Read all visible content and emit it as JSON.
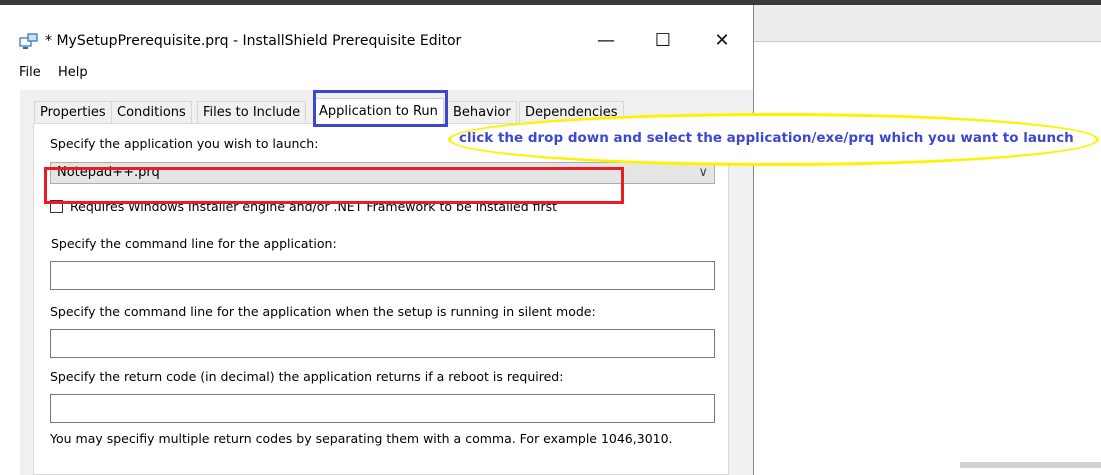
{
  "window": {
    "title": "* MySetupPrerequisite.prq - InstallShield Prerequisite Editor",
    "minimize_glyph": "—",
    "maximize_glyph": "☐",
    "close_glyph": "✕"
  },
  "menu": {
    "file": "File",
    "help": "Help"
  },
  "tabs": [
    {
      "label": "Properties"
    },
    {
      "label": "Conditions"
    },
    {
      "label": "Files to Include"
    },
    {
      "label": "Application to Run",
      "active": true
    },
    {
      "label": "Behavior"
    },
    {
      "label": "Dependencies"
    }
  ],
  "panel": {
    "launch_label": "Specify the application you wish to launch:",
    "application_value": "Notepad++.prq",
    "requires_label": "Requires Windows Installer engine and/or .NET Framework to be installed first",
    "requires_checked": false,
    "cmdline_label": "Specify the command line for the application:",
    "cmdline_value": "",
    "silent_label": "Specify the command line for the application when the setup is running in silent mode:",
    "silent_value": "",
    "return_label": "Specify the return code (in decimal) the application returns if a reboot is required:",
    "return_value": "",
    "hint": "You may specifiy multiple return codes by separating them with a comma.  For example 1046,3010."
  },
  "annotation": {
    "callout_text": "click the drop down and select the application/exe/prq which you want to launch",
    "colors": {
      "red": "#ed1c24",
      "blue": "#3f48cc",
      "yellow": "#fff200"
    }
  }
}
